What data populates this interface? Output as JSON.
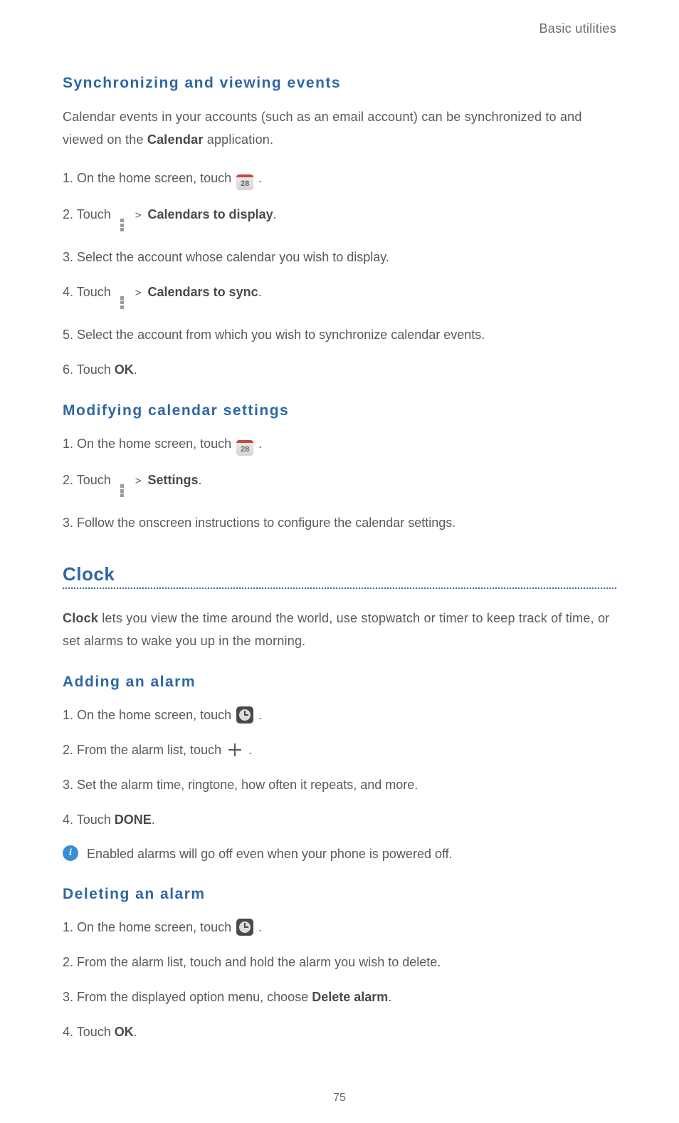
{
  "header": {
    "chapter": "Basic utilities"
  },
  "sync_section": {
    "heading": "Synchronizing  and  viewing  events",
    "intro_prefix": "Calendar events in your accounts (such as an email account) can be synchronized to and viewed on the ",
    "intro_bold": "Calendar",
    "intro_suffix": " application.",
    "steps": {
      "s1_prefix": "1. On the home screen, touch ",
      "s1_suffix": " .",
      "s2_prefix": "2. Touch ",
      "s2_bold": "Calendars to display",
      "s2_suffix": ".",
      "s3": "3. Select the account whose calendar you wish to display.",
      "s4_prefix": "4. Touch ",
      "s4_bold": "Calendars to sync",
      "s4_suffix": ".",
      "s5": "5. Select the account from which you wish to synchronize calendar events.",
      "s6_prefix": "6. Touch ",
      "s6_bold": "OK",
      "s6_suffix": "."
    }
  },
  "modify_section": {
    "heading": "Modifying  calendar  settings",
    "steps": {
      "s1_prefix": "1. On the home screen, touch ",
      "s1_suffix": " .",
      "s2_prefix": "2. Touch ",
      "s2_bold": "Settings",
      "s2_suffix": ".",
      "s3": "3. Follow the onscreen instructions to configure the calendar settings."
    }
  },
  "clock_section": {
    "title": "Clock",
    "intro_bold": "Clock",
    "intro_rest": " lets you view the time around the world, use stopwatch or timer to keep track of time, or set alarms to wake you up in the morning."
  },
  "add_alarm": {
    "heading": "Adding  an  alarm",
    "steps": {
      "s1_prefix": "1. On the home screen, touch ",
      "s1_suffix": " .",
      "s2_prefix": "2. From the alarm list, touch ",
      "s2_suffix": " .",
      "s3": "3. Set the alarm time, ringtone, how often it repeats, and more.",
      "s4_prefix": "4. Touch ",
      "s4_bold": "DONE",
      "s4_suffix": "."
    },
    "note": "Enabled alarms will go off even when your phone is powered off."
  },
  "delete_alarm": {
    "heading": "Deleting  an  alarm",
    "steps": {
      "s1_prefix": "1. On the home screen, touch ",
      "s1_suffix": " .",
      "s2": "2. From the alarm list, touch and hold the alarm you wish to delete.",
      "s3_prefix": "3. From the displayed option menu, choose ",
      "s3_bold": "Delete alarm",
      "s3_suffix": ".",
      "s4_prefix": "4. Touch ",
      "s4_bold": "OK",
      "s4_suffix": "."
    }
  },
  "page_number": "75",
  "icons": {
    "calendar_label": "28"
  }
}
